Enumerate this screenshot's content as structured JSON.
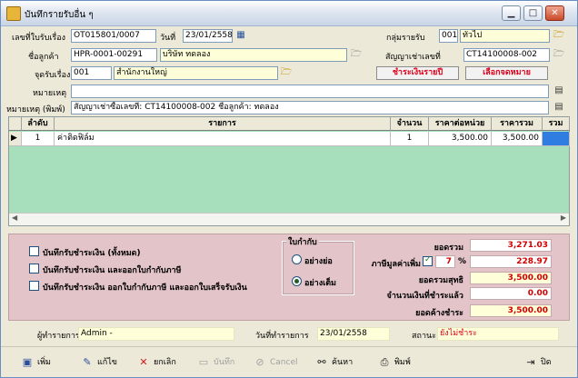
{
  "window": {
    "title": "บันทึกรายรับอื่น ๆ"
  },
  "header": {
    "doc_no_label": "เลขที่ใบรับเรื่อง",
    "doc_no": "OT015801/0007",
    "date_label": "วันที่",
    "date": "23/01/2558",
    "group_label": "กลุ่มรายรับ",
    "group_code": "001",
    "group_name": "ทั่วไป",
    "customer_label": "ชื่อลูกค้า",
    "customer_code": "HPR-0001-00291",
    "customer_name": "บริษัท ทดลอง",
    "contract_label": "สัญญาเช่าเลขที่",
    "contract_no": "CT14100008-002",
    "point_label": "จุดรับเรื่อง",
    "point_code": "001",
    "point_name": "สำนักงานใหญ่",
    "btn_pay_yearly": "ชำระเงินรายปี",
    "btn_select_notice": "เลือกจดหมาย",
    "note_label": "หมายเหตุ",
    "note_value": "",
    "note_print_label": "หมายเหตุ (พิมพ์)",
    "note_print_value": "สัญญาเช่าซื้อเลขที่: CT14100008-002 ชื่อลูกค้า: ทดลอง"
  },
  "grid": {
    "columns": [
      "ลำดับ",
      "รายการ",
      "จำนวน",
      "ราคาต่อหน่วย",
      "ราคารวม",
      "รวมภาษี"
    ],
    "rows": [
      {
        "seq": "1",
        "item": "ค่าติดฟิล์ม",
        "qty": "1",
        "unit_price": "3,500.00",
        "total": "3,500.00",
        "vat": ""
      }
    ]
  },
  "options": {
    "chk_all": "บันทึกรับชำระเงิน (ทั้งหมด)",
    "chk_tax": "บันทึกรับชำระเงิน และออกใบกำกับภาษี",
    "chk_tax_receipt": "บันทึกรับชำระเงิน ออกใบกำกับภาษี และออกใบเสร็จรับเงิน",
    "invoice_group": "ใบกำกับ",
    "radio_short": "อย่างย่อ",
    "radio_full": "อย่างเต็ม"
  },
  "totals": {
    "sum_label": "ยอดรวม",
    "sum": "3,271.03",
    "vat_label": "ภาษีมูลค่าเพิ่ม",
    "vat_rate": "7",
    "vat_pct": "%",
    "vat": "228.97",
    "net_label": "ยอดรวมสุทธิ",
    "net": "3,500.00",
    "paid_label": "จำนวนเงินที่ชำระแล้ว",
    "paid": "0.00",
    "due_label": "ยอดค้างชำระ",
    "due": "3,500.00"
  },
  "status": {
    "creator_label": "ผู้ทำรายการ",
    "creator": "Admin -",
    "created_date_label": "วันที่ทำรายการ",
    "created_date": "23/01/2558",
    "state_label": "สถานะ",
    "state": "ยังไม่ชำระ"
  },
  "toolbar": {
    "add": "เพิ่ม",
    "edit": "แก้ไข",
    "void": "ยกเลิก",
    "save": "บันทึก",
    "cancel": "Cancel",
    "search": "ค้นหา",
    "print": "พิมพ์",
    "close": "ปิด"
  }
}
